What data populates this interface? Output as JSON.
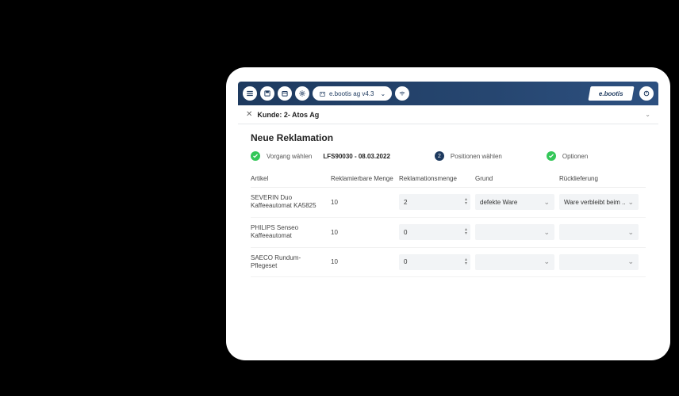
{
  "topbar": {
    "context_label": "e.bootis ag v4.3",
    "brand": "e.bootis"
  },
  "breadcrumb": {
    "text": "Kunde: 2- Atos Ag"
  },
  "page": {
    "title": "Neue Reklamation"
  },
  "steps": {
    "s1_label": "Vorgang wählen",
    "s1_info": "LFS90030 - 08.03.2022",
    "s2_num": "2",
    "s2_label": "Positionen wählen",
    "s3_label": "Optionen"
  },
  "table": {
    "headers": {
      "artikel": "Artikel",
      "reklamierbar": "Reklamierbare Menge",
      "reklamation": "Reklamationsmenge",
      "grund": "Grund",
      "rueck": "Rücklieferung"
    },
    "rows": [
      {
        "artikel": "SEVERIN Duo Kaffeeautomat KA5825",
        "reklamierbar": "10",
        "reklamation": "2",
        "grund": "defekte Ware",
        "rueck": "Ware verbleibt beim .."
      },
      {
        "artikel": "PHILIPS Senseo Kaffeeautomat",
        "reklamierbar": "10",
        "reklamation": "0",
        "grund": "",
        "rueck": ""
      },
      {
        "artikel": "SAECO Rundum-Pflegeset",
        "reklamierbar": "10",
        "reklamation": "0",
        "grund": "",
        "rueck": ""
      }
    ]
  }
}
